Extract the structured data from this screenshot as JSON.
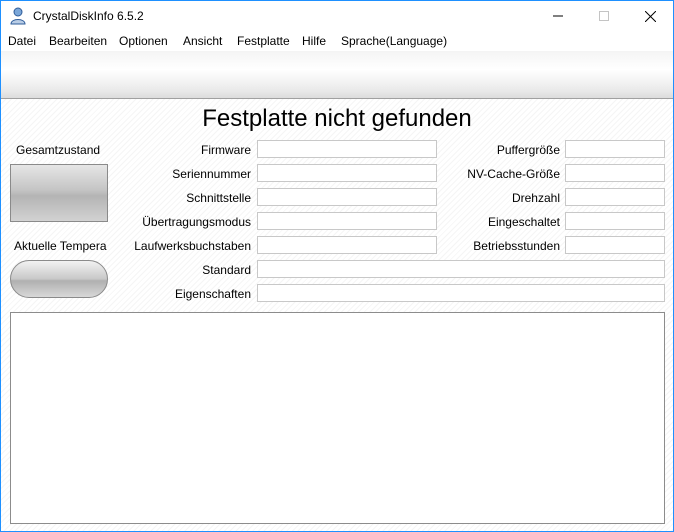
{
  "window": {
    "title": "CrystalDiskInfo 6.5.2"
  },
  "menu": [
    "Datei",
    "Bearbeiten",
    "Optionen",
    "Ansicht",
    "Festplatte",
    "Hilfe",
    "Sprache(Language)"
  ],
  "main": {
    "heading": "Festplatte nicht gefunden",
    "health_label": "Gesamtzustand",
    "temp_label": "Aktuelle Tempera",
    "left_fields": [
      {
        "label": "Firmware",
        "value": ""
      },
      {
        "label": "Seriennummer",
        "value": ""
      },
      {
        "label": "Schnittstelle",
        "value": ""
      },
      {
        "label": "Übertragungsmodus",
        "value": ""
      },
      {
        "label": "Laufwerksbuchstaben",
        "value": ""
      }
    ],
    "right_fields": [
      {
        "label": "Puffergröße",
        "value": ""
      },
      {
        "label": "NV-Cache-Größe",
        "value": ""
      },
      {
        "label": "Drehzahl",
        "value": ""
      },
      {
        "label": "Eingeschaltet",
        "value": ""
      },
      {
        "label": "Betriebsstunden",
        "value": ""
      }
    ],
    "wide_fields": [
      {
        "label": "Standard",
        "value": ""
      },
      {
        "label": "Eigenschaften",
        "value": ""
      }
    ],
    "log": ""
  }
}
